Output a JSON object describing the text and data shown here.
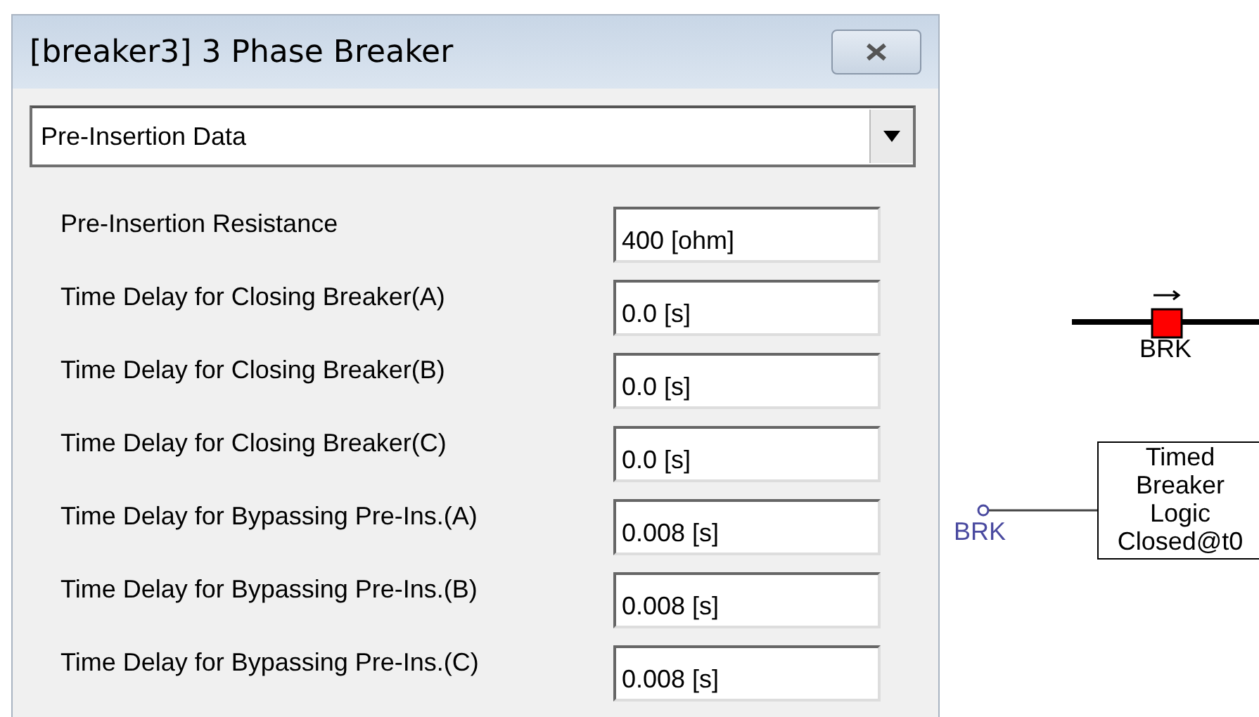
{
  "window": {
    "title": "[breaker3] 3 Phase Breaker"
  },
  "dropdown": {
    "value": "Pre-Insertion Data"
  },
  "parameters": [
    {
      "label": "Pre-Insertion  Resistance",
      "value": "400 [ohm]"
    },
    {
      "label": "Time Delay for Closing Breaker(A)",
      "value": "0.0 [s]"
    },
    {
      "label": "Time Delay for Closing Breaker(B)",
      "value": "0.0 [s]"
    },
    {
      "label": "Time Delay for Closing Breaker(C)",
      "value": "0.0 [s]"
    },
    {
      "label": "Time Delay for Bypassing Pre-Ins.(A)",
      "value": "0.008 [s]"
    },
    {
      "label": "Time Delay for Bypassing Pre-Ins.(B)",
      "value": "0.008 [s]"
    },
    {
      "label": "Time Delay for Bypassing Pre-Ins.(C)",
      "value": "0.008 [s]"
    }
  ],
  "diagram": {
    "breaker": {
      "label": "BRK",
      "color": "#ff0000"
    },
    "signal_label": "BRK",
    "logic_block": {
      "lines": [
        "Timed",
        "Breaker",
        "Logic",
        "Closed@t0"
      ]
    }
  }
}
